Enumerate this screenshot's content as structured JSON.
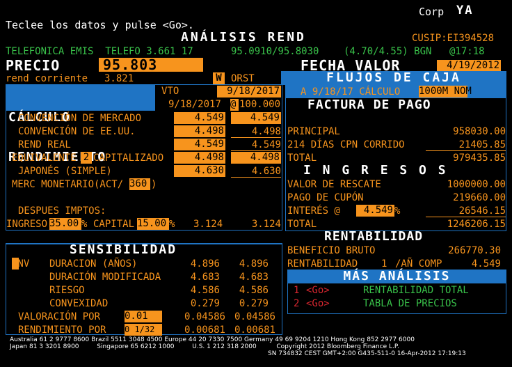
{
  "header": {
    "corp": "Corp",
    "ticker": "YA",
    "prompt": "Teclee los datos y pulse <Go>.",
    "title": "ANÁLISIS REND",
    "cusip": "CUSIP:EI394528",
    "bond_line": "TELEFONICA EMIS  TELEFO 3.661 17",
    "bid_ask": "95.0910/95.8030",
    "yields": "(4.70/4.55) BGN",
    "time": "@17:18"
  },
  "price": {
    "label": "PRECIO",
    "value": "95.803",
    "current_yield_label": "rend corriente",
    "current_yield": "3.821",
    "w_flag": "W",
    "orst": "ORST",
    "settle_label": "FECHA VALOR",
    "settle_date": "4/19/2012"
  },
  "calc": {
    "title1": "CÁLCULO",
    "title2": "RENDIMIENTO",
    "vto_label": "VTO",
    "vto_date": "9/18/2017",
    "date2": "9/18/2017",
    "at": "@",
    "redemption": "100.000",
    "rows": [
      {
        "label": "CONVENCIÓN DE MERCADO",
        "v1": "4.549",
        "v2": "4.549"
      },
      {
        "label": "CONVENCIÓN DE EE.UU.",
        "v1": "4.498",
        "v2": "4.498"
      },
      {
        "label": "REND REAL",
        "v1": "4.549",
        "v2": "4.549"
      },
      {
        "label": "EQUIVALENTE",
        "num": "2",
        "label2": "CAPITALIZADO",
        "v1": "4.498",
        "v2": "4.498"
      },
      {
        "label": "JAPONÉS (SIMPLE)",
        "v1": "4.630",
        "v2": "4.630"
      }
    ],
    "money_market_label": "MERC MONETARIO(ACT/",
    "money_market_days": "360",
    "money_market_close": ")",
    "after_tax_label": "DESPUES IMPTOS:",
    "income_label": "INGRESO",
    "income_pct": "35.00",
    "pct_sign": "%",
    "capital_label": "CAPITAL",
    "capital_pct": "15.00",
    "after_tax_v1": "3.124",
    "after_tax_v2": "3.124"
  },
  "cashflow": {
    "title": "FLUJOS DE CAJA",
    "calc_label": "A 9/18/17 CÁLCULO",
    "face": "1000M NOM",
    "invoice_title": "FACTURA DE PAGO",
    "principal_label": "PRINCIPAL",
    "principal": "958030.00",
    "accrued_label": "214 DÍAS CPN CORRIDO",
    "accrued": "21405.85",
    "total_label": "TOTAL",
    "total": "979435.85",
    "income_title": "I N G R E S O S",
    "redemption_label": "VALOR DE RESCATE",
    "redemption_value": "1000000.00",
    "coupon_label": "PAGO DE CUPÓN",
    "coupon_value": "219660.00",
    "interest_label": "INTERÉS @",
    "interest_rate": "4.549",
    "interest_pct": "%",
    "interest_value": "26546.15",
    "income_total_label": "TOTAL",
    "income_total": "1246206.15",
    "return_title": "RENTABILIDAD",
    "gross_label": "BENEFICIO BRUTO",
    "gross_value": "266770.30",
    "return_label": "RENTABILIDAD",
    "return_num": "1",
    "return_comp": "/AÑ COMP",
    "return_value": "4.549"
  },
  "more": {
    "title": "MÁS ANÁLISIS",
    "items": [
      {
        "num": "1",
        "go": "<Go>",
        "label": "RENTABILIDAD TOTAL"
      },
      {
        "num": "2",
        "go": "<Go>",
        "label": "TABLA DE PRECIOS"
      }
    ]
  },
  "sens": {
    "title": "SENSIBILIDAD",
    "cnv": "CNV",
    "rows": [
      {
        "label": "DURACION (AÑOS)",
        "v1": "4.896",
        "v2": "4.896"
      },
      {
        "label": "DURACIÓN MODIFICADA",
        "v1": "4.683",
        "v2": "4.683"
      },
      {
        "label": "RIESGO",
        "v1": "4.586",
        "v2": "4.586"
      },
      {
        "label": "CONVEXIDAD",
        "v1": "0.279",
        "v2": "0.279"
      }
    ],
    "val_label": "VALORACIÓN POR",
    "val_input": "0.01",
    "val_v1": "0.04586",
    "val_v2": "0.04586",
    "yield_label": "RENDIMIENTO POR",
    "yield_input": "0 1/32",
    "yield_v1": "0.00681",
    "yield_v2": "0.00681"
  },
  "footer": {
    "line1": "Australia 61 2 9777 8600 Brazil 5511 3048 4500 Europe 44 20 7330 7500 Germany 49 69 9204 1210 Hong Kong 852 2977 6000",
    "line2": "Japan 81 3 3201 8900         Singapore 65 6212 1000         U.S. 1 212 318 2000          Copyright 2012 Bloomberg Finance L.P.",
    "line3": "SN 734832 CEST GMT+2:00 G435-511-0 16-Apr-2012 17:19:13"
  },
  "colors": {
    "orange": "#f7941d",
    "blue": "#1f74c4",
    "green": "#39c24a",
    "red": "#d8262f",
    "white": "#ffffff"
  }
}
